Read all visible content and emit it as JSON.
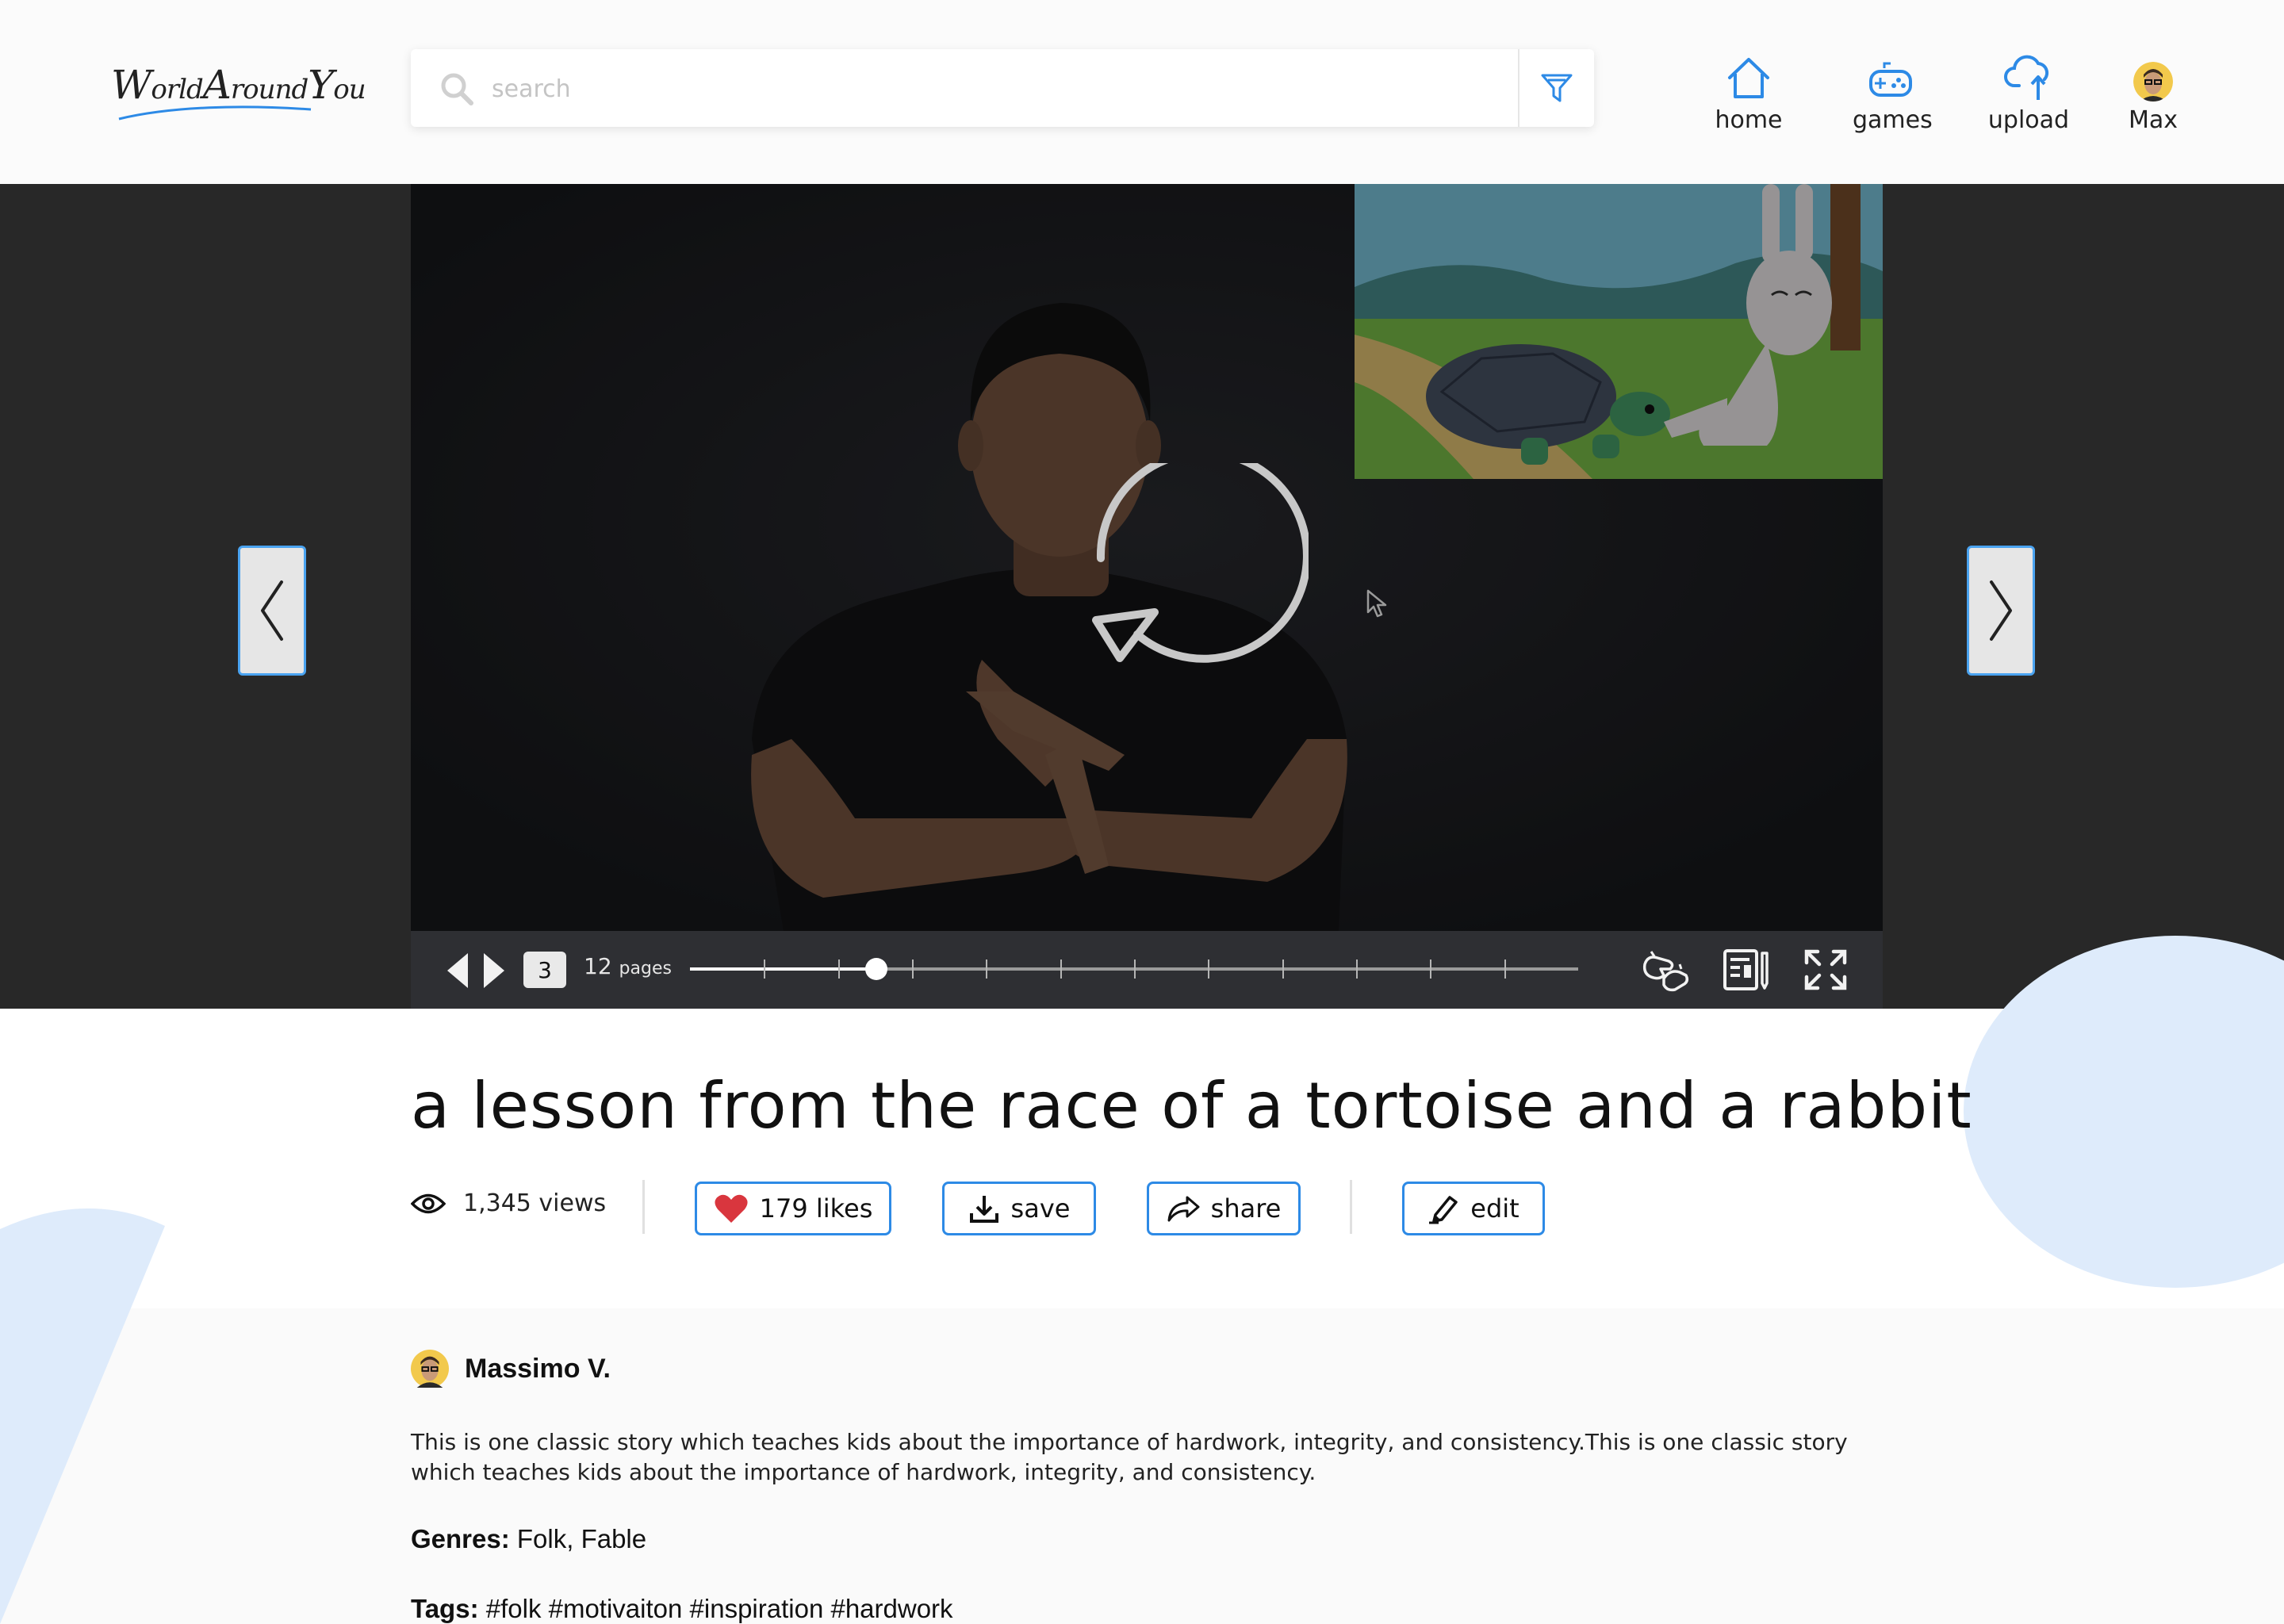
{
  "header": {
    "logo_text": "WorldAroundYou",
    "search": {
      "placeholder": "search",
      "value": ""
    },
    "nav": [
      {
        "label": "home",
        "icon": "home-icon"
      },
      {
        "label": "games",
        "icon": "gamepad-icon"
      },
      {
        "label": "upload",
        "icon": "cloud-upload-icon"
      },
      {
        "label": "Max",
        "icon": "avatar"
      }
    ]
  },
  "player": {
    "current_page": "3",
    "page_count": "12",
    "pages_word": "pages",
    "progress_fraction": 0.21,
    "page_ticks": 12
  },
  "story": {
    "title": "a lesson from the race of a tortoise and a rabbit",
    "views": "1,345 views",
    "likes_label": "179 likes",
    "save_label": "save",
    "share_label": "share",
    "edit_label": "edit",
    "author_name": "Massimo V.",
    "description": "This is one classic story which teaches kids about the importance of hardwork, integrity, and consistency.This is one classic story which teaches kids about the importance of hardwork, integrity, and consistency.",
    "genres_label": "Genres:",
    "genres_value": "Folk, Fable",
    "tags_label": "Tags:",
    "tags_value": "#folk #motivaiton #inspiration #hardwork"
  },
  "colors": {
    "accent_blue": "#2d8ae6",
    "heart_red": "#d9363e",
    "player_bg": "#282828",
    "blob_blue": "#deebfb"
  }
}
